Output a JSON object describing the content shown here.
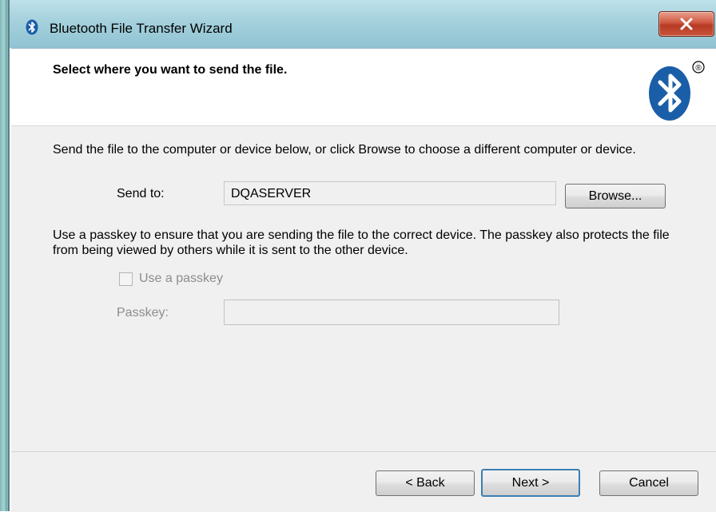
{
  "window": {
    "title": "Bluetooth File Transfer Wizard"
  },
  "header": {
    "title": "Select where you want to send the file.",
    "logo_mark": "®"
  },
  "send_section": {
    "description": "Send the file to the computer or device below, or click Browse to choose a different computer or device.",
    "send_to_label": "Send to:",
    "send_to_value": "DQASERVER",
    "browse_label": "Browse..."
  },
  "passkey_section": {
    "description": "Use a passkey to ensure that you are sending the file to the correct device. The passkey also protects the file from being viewed by others while it is sent to the other device.",
    "use_passkey_label": "Use a passkey",
    "use_passkey_checked": false,
    "passkey_label": "Passkey:",
    "passkey_value": ""
  },
  "footer": {
    "back_label": "< Back",
    "next_label": "Next >",
    "cancel_label": "Cancel"
  },
  "colors": {
    "bluetooth_blue": "#1a5ea8",
    "close_red": "#c8543a",
    "default_button_border": "#3c7fb1"
  },
  "icons": {
    "titlebar": "bluetooth-icon",
    "close": "close-icon",
    "header_logo": "bluetooth-logo"
  }
}
